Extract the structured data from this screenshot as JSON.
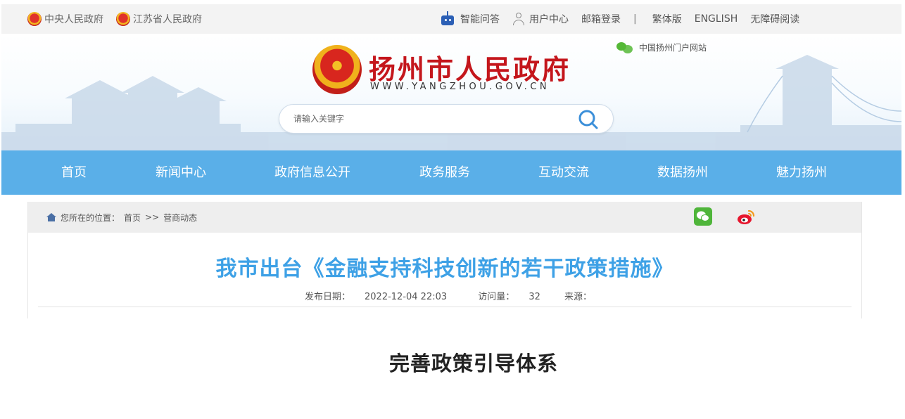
{
  "topbar": {
    "links": [
      "中央人民政府",
      "江苏省人民政府"
    ],
    "smart_qa": "智能问答",
    "user_center": "用户中心",
    "mail_login": "邮箱登录",
    "divider": "|",
    "traditional": "繁体版",
    "english": "ENGLISH",
    "accessible": "无障碍阅读"
  },
  "header": {
    "site_title": "扬州市人民政府",
    "site_url": "WWW.YANGZHOU.GOV.CN",
    "portal_label": "中国扬州门户网站",
    "search_placeholder": "请输入关键字"
  },
  "nav": {
    "items": [
      "首页",
      "新闻中心",
      "政府信息公开",
      "政务服务",
      "互动交流",
      "数据扬州",
      "魅力扬州"
    ]
  },
  "breadcrumb": {
    "prefix": "您所在的位置：",
    "home": "首页",
    "sep": ">>",
    "current": "营商动态"
  },
  "article": {
    "title": "我市出台《金融支持科技创新的若干政策措施》",
    "date_label": "发布日期：",
    "date": "2022-12-04 22:03",
    "views_label": "访问量：",
    "views": "32",
    "source_label": "来源："
  },
  "caption": "完善政策引导体系",
  "colors": {
    "nav_bg": "#5aafe8",
    "title_red": "#c4161c",
    "article_title": "#3ea1e6"
  },
  "icons": [
    "national-emblem-icon",
    "robot-icon",
    "user-icon",
    "wechat-icon",
    "search-icon",
    "home-icon",
    "weibo-icon"
  ]
}
